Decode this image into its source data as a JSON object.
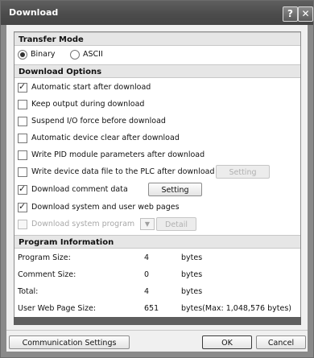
{
  "window": {
    "title": "Download",
    "help_glyph": "?",
    "close_glyph": "✕"
  },
  "transfer_mode": {
    "heading": "Transfer Mode",
    "options": [
      {
        "label": "Binary",
        "selected": true
      },
      {
        "label": "ASCII",
        "selected": false
      }
    ]
  },
  "download_options": {
    "heading": "Download Options",
    "items": [
      {
        "label": "Automatic start after download",
        "checked": true,
        "enabled": true
      },
      {
        "label": "Keep output during download",
        "checked": false,
        "enabled": true
      },
      {
        "label": "Suspend I/O force before download",
        "checked": false,
        "enabled": true
      },
      {
        "label": "Automatic device clear after download",
        "checked": false,
        "enabled": true
      },
      {
        "label": "Write PID module parameters after download",
        "checked": false,
        "enabled": true
      },
      {
        "label": "Write device data file to the PLC after download",
        "checked": false,
        "enabled": true,
        "button": "Setting",
        "button_enabled": false
      },
      {
        "label": "Download comment data",
        "checked": true,
        "enabled": true,
        "button": "Setting",
        "button_enabled": true
      },
      {
        "label": "Download system and user web pages",
        "checked": true,
        "enabled": true
      },
      {
        "label": "Download system program",
        "checked": false,
        "enabled": false,
        "button": "Detail",
        "button_enabled": false
      }
    ]
  },
  "program_info": {
    "heading": "Program Information",
    "rows": [
      {
        "name": "Program Size:",
        "value": "4",
        "unit": "bytes"
      },
      {
        "name": "Comment Size:",
        "value": "0",
        "unit": "bytes"
      },
      {
        "name": "Total:",
        "value": "4",
        "unit": "bytes"
      },
      {
        "name": "User Web Page Size:",
        "value": "651",
        "unit": "bytes(Max: 1,048,576 bytes)"
      }
    ]
  },
  "footer": {
    "comm_button": "Communication Settings",
    "ok": "OK",
    "cancel": "Cancel"
  }
}
